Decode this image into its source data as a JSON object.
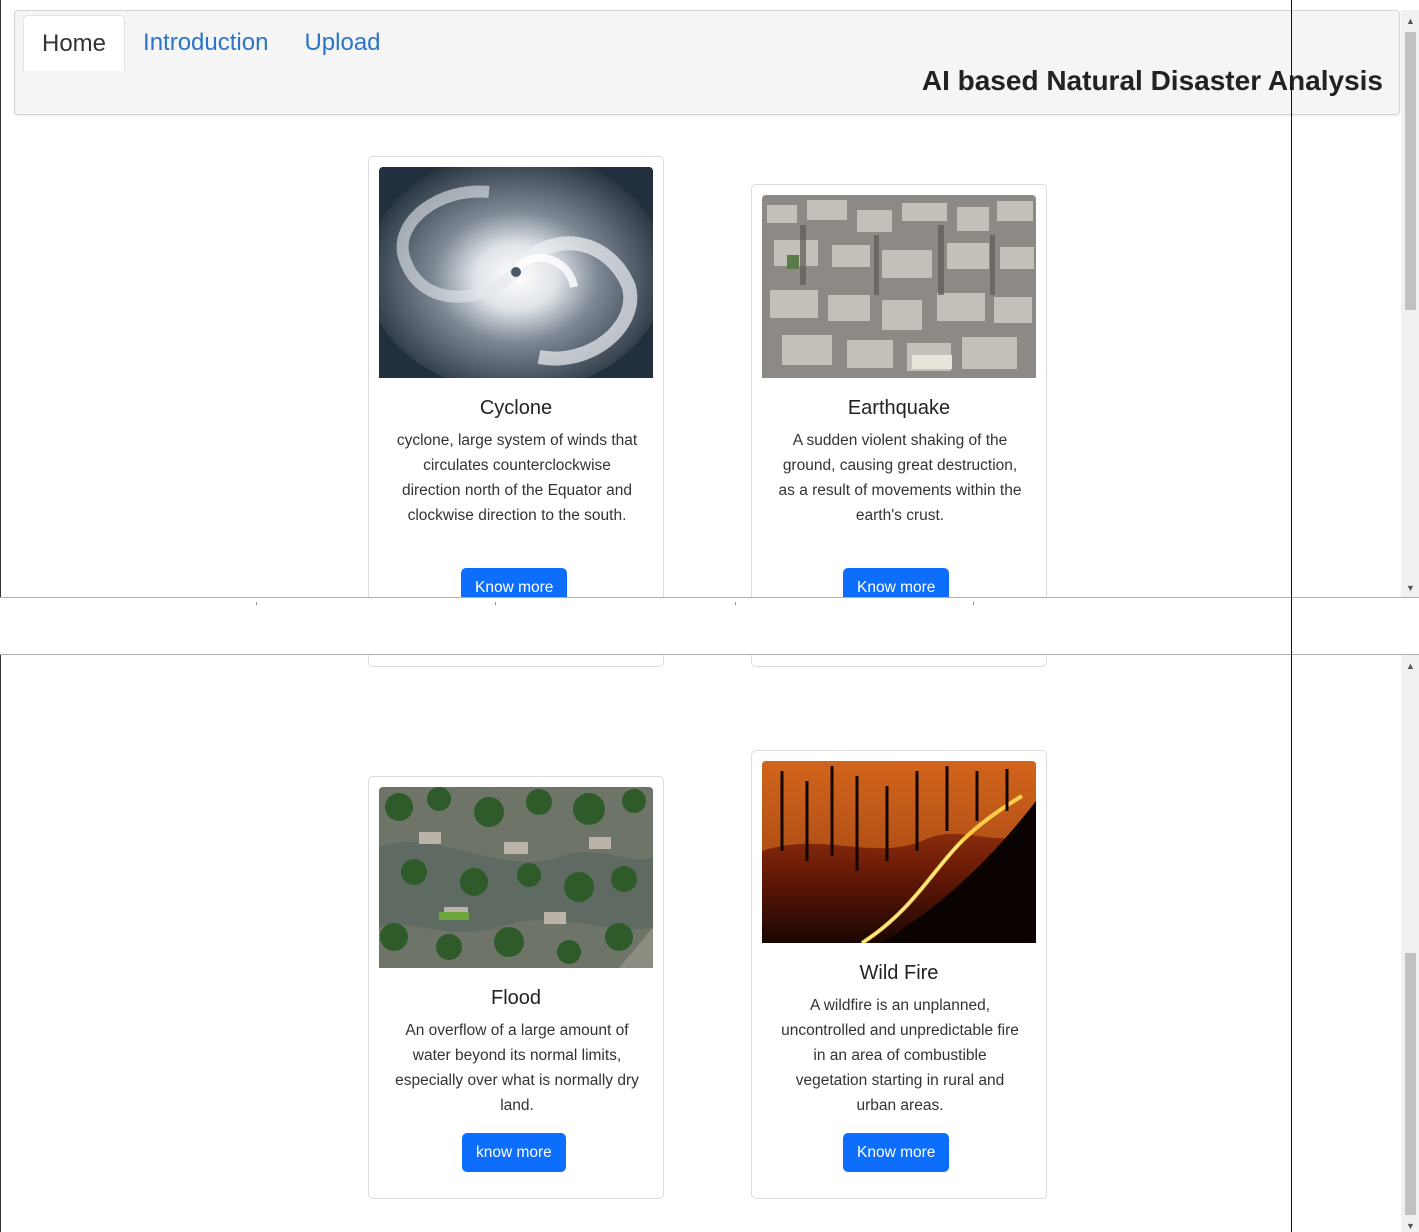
{
  "nav": {
    "tabs": [
      {
        "label": "Home",
        "active": true
      },
      {
        "label": "Introduction",
        "active": false
      },
      {
        "label": "Upload",
        "active": false
      }
    ],
    "title": "AI based Natural Disaster Analysis"
  },
  "cards": {
    "cyclone": {
      "title": "Cyclone",
      "text": "cyclone, large system of winds that circulates counterclockwise direction north of the Equator and clockwise direction to the south.",
      "button": "Know more",
      "image_icon": "cyclone-satellite-image"
    },
    "earthquake": {
      "title": "Earthquake",
      "text": "A sudden violent shaking of the ground, causing great destruction, as a result of movements within the earth's crust.",
      "button": "Know more",
      "image_icon": "earthquake-rubble-image"
    },
    "flood": {
      "title": "Flood",
      "text": "An overflow of a large amount of water beyond its normal limits, especially over what is normally dry land.",
      "button": "know more",
      "image_icon": "flood-aerial-image"
    },
    "wildfire": {
      "title": "Wild Fire",
      "text": "A wildfire is an unplanned, uncontrolled and unpredictable fire in an area of combustible vegetation starting in rural and urban areas.",
      "button": "Know more",
      "image_icon": "wildfire-forest-image"
    }
  },
  "colors": {
    "link": "#2a74c9",
    "button": "#0d6efd",
    "navbar_bg": "#f5f5f5"
  }
}
